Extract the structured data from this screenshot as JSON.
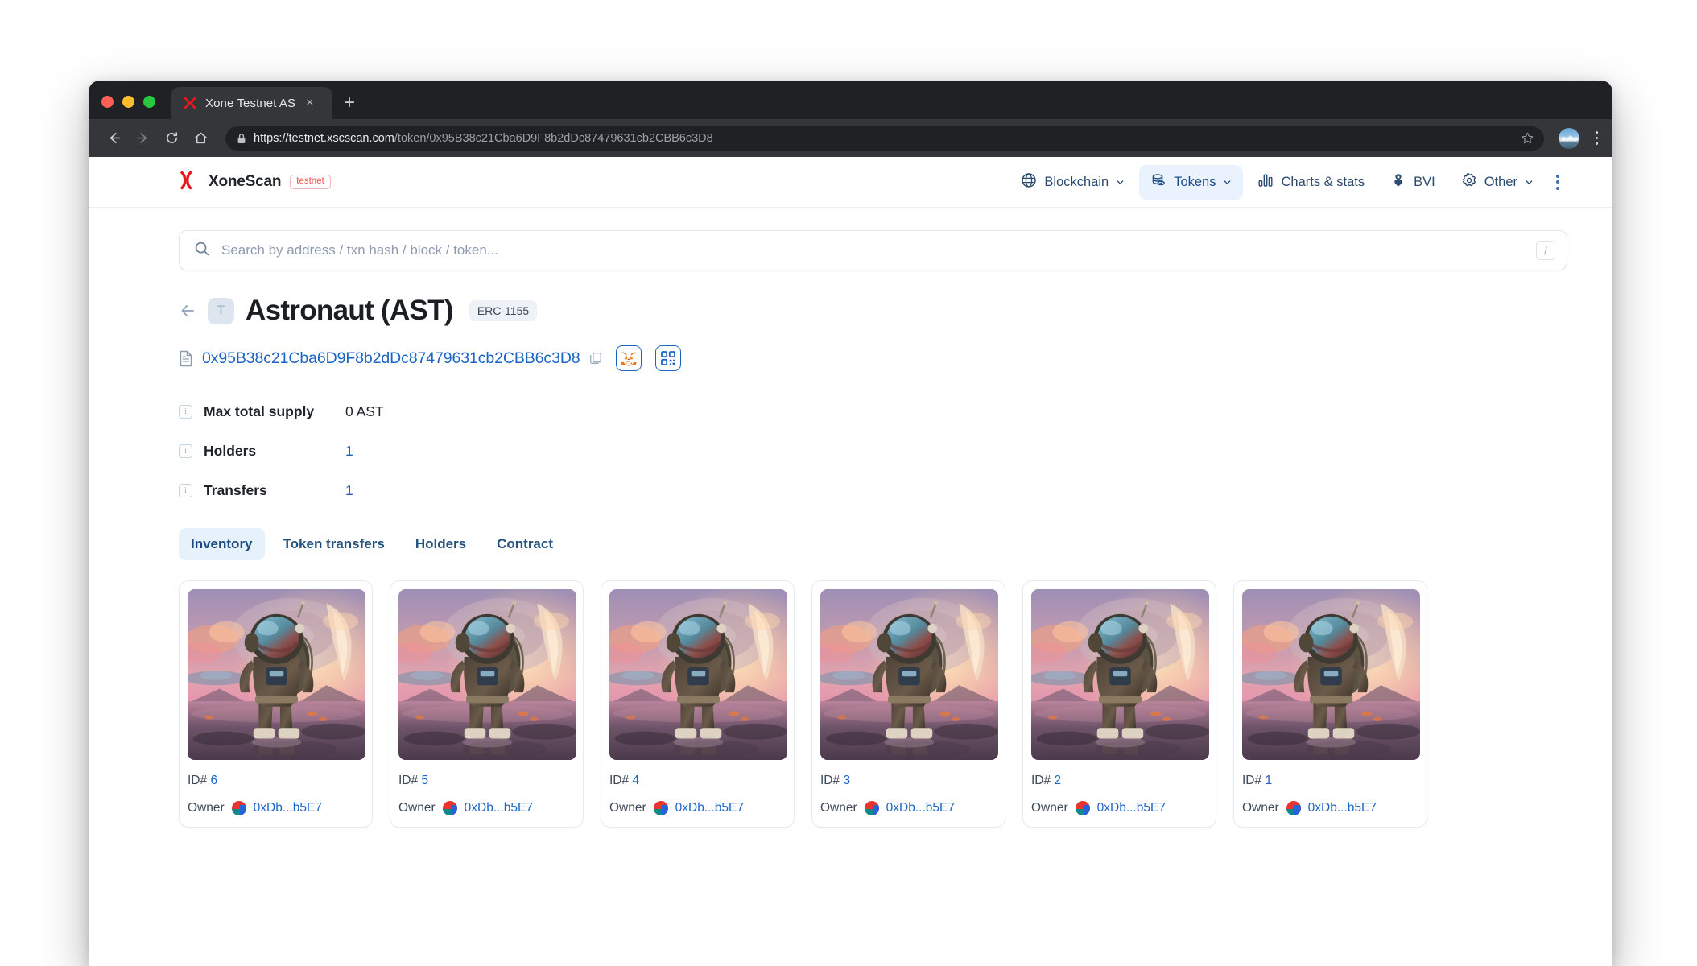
{
  "browser": {
    "tab": {
      "title": "Xone Testnet AS",
      "favicon": "xone-x-icon",
      "close_label": "×"
    },
    "new_tab_label": "+",
    "url_host": "https://testnet.xscscan.com",
    "url_path": "/token/0x95B38c21Cba6D9F8b2dDc87479631cb2CBB6c3D8",
    "nav": {
      "back": "back-icon",
      "forward": "forward-icon",
      "reload": "reload-icon",
      "home": "home-icon"
    }
  },
  "header": {
    "brand_name": "XoneScan",
    "brand_chip": "testnet",
    "nav_items": [
      {
        "label": "Blockchain",
        "icon": "globe-icon",
        "has_caret": true,
        "active": false
      },
      {
        "label": "Tokens",
        "icon": "coins-icon",
        "has_caret": true,
        "active": true
      },
      {
        "label": "Charts & stats",
        "icon": "bar-chart-icon",
        "has_caret": false,
        "active": false
      },
      {
        "label": "BVI",
        "icon": "flower-icon",
        "has_caret": false,
        "active": false
      },
      {
        "label": "Other",
        "icon": "gear-icon",
        "has_caret": true,
        "active": false
      }
    ]
  },
  "search": {
    "placeholder": "Search by address / txn hash / block / token...",
    "shortcut_key": "/"
  },
  "token": {
    "avatar_letter": "T",
    "title": "Astronaut (AST)",
    "standard": "ERC-1155",
    "address": "0x95B38c21Cba6D9F8b2dDc87479631cb2CBB6c3D8",
    "actions": [
      {
        "name": "metamask-add-token-button",
        "icon": "metamask-fox-icon"
      },
      {
        "name": "qr-code-button",
        "icon": "qr-code-icon"
      }
    ]
  },
  "stats": [
    {
      "label": "Max total supply",
      "value": "0 AST",
      "is_link": false
    },
    {
      "label": "Holders",
      "value": "1",
      "is_link": true
    },
    {
      "label": "Transfers",
      "value": "1",
      "is_link": true
    }
  ],
  "tabs": [
    {
      "label": "Inventory",
      "active": true
    },
    {
      "label": "Token transfers",
      "active": false
    },
    {
      "label": "Holders",
      "active": false
    },
    {
      "label": "Contract",
      "active": false
    }
  ],
  "inventory": {
    "owner_label": "Owner",
    "id_prefix": "ID# ",
    "items": [
      {
        "id": "6",
        "owner": "0xDb...b5E7"
      },
      {
        "id": "5",
        "owner": "0xDb...b5E7"
      },
      {
        "id": "4",
        "owner": "0xDb...b5E7"
      },
      {
        "id": "3",
        "owner": "0xDb...b5E7"
      },
      {
        "id": "2",
        "owner": "0xDb...b5E7"
      },
      {
        "id": "1",
        "owner": "0xDb...b5E7"
      }
    ]
  },
  "colors": {
    "brand_red": "#e8181e",
    "link_blue": "#1c64c4",
    "nav_active_bg": "#eaf3fd",
    "testnet_chip": "#f05252"
  }
}
